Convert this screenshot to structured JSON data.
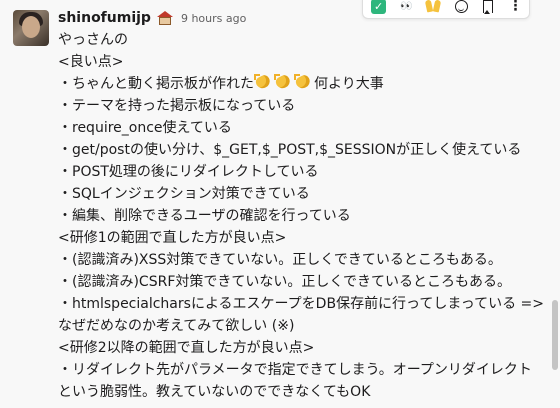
{
  "message": {
    "username": "shinofumijp",
    "status_emoji": "house-icon",
    "timestamp": "9 hours ago",
    "lines": [
      "やっさんの",
      "<良い点>",
      "・ちゃんと動く掲示板が作れた",
      "・テーマを持った掲示板になっている",
      "・require_once使えている",
      "・get/postの使い分け、$_GET,$_POST,$_SESSIONが正しく使えている",
      "・POST処理の後にリダイレクトしている",
      "・SQLインジェクション対策できている",
      "・編集、削除できるユーザの確認を行っている",
      "<研修1の範囲で直した方が良い点>",
      "・(認識済み)XSS対策できていない。正しくできているところもある。",
      "・(認識済み)CSRF対策できていない。正しくできているところもある。",
      "・htmlspecialcharsによるエスケープをDB保存前に行ってしまっている =>",
      "なぜだめなのか考えてみて欲しい (※)",
      "<研修2以降の範囲で直した方が良い点>",
      "・リダイレクト先がパラメータで指定できてしまう。オープンリダイレクト",
      "という脆弱性。教えていないのでできなくてもOK"
    ],
    "line2_suffix": "何より大事",
    "inline_emoji": [
      "clap-icon",
      "clap-icon",
      "clap-icon"
    ]
  },
  "toolbar": {
    "buttons": [
      {
        "name": "check-reaction-button",
        "icon": "check-icon"
      },
      {
        "name": "eyes-reaction-button",
        "icon": "eyes-icon"
      },
      {
        "name": "raised-hands-reaction-button",
        "icon": "raised-hands-icon"
      },
      {
        "name": "add-reaction-button",
        "icon": "add-emoji-icon"
      },
      {
        "name": "save-message-button",
        "icon": "bookmark-icon"
      },
      {
        "name": "more-actions-button",
        "icon": "more-icon"
      }
    ],
    "check_glyph": "✓",
    "eyes_glyph": "👀",
    "more_glyph": "⋮"
  },
  "colors": {
    "background": "#f8f8f8",
    "text": "#1d1c1d",
    "timestamp": "#616061",
    "check_green": "#2eb67d"
  }
}
